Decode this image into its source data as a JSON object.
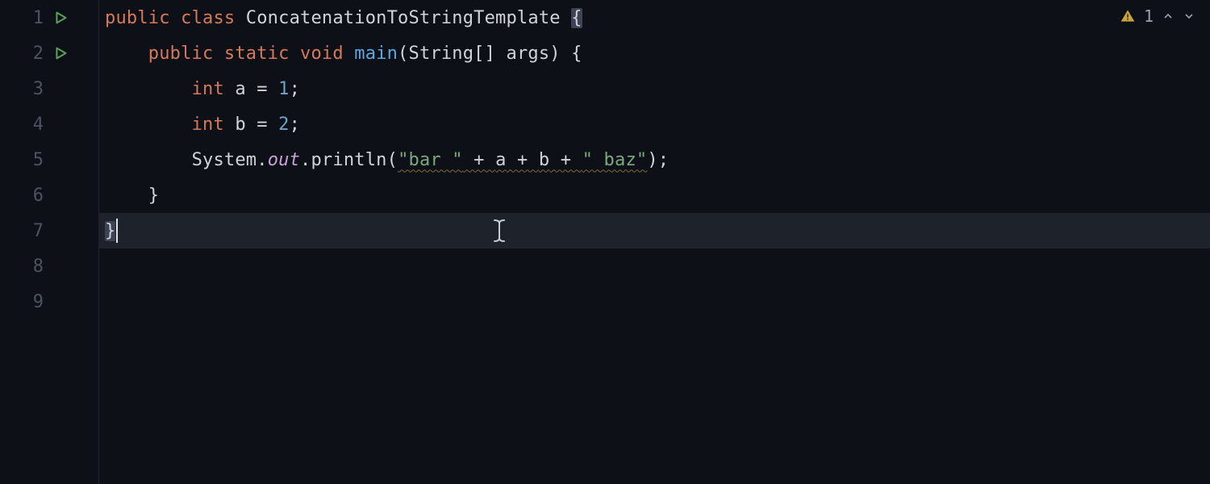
{
  "inspection": {
    "warning_count": "1"
  },
  "gutter": {
    "lines": [
      "1",
      "2",
      "3",
      "4",
      "5",
      "6",
      "7",
      "8",
      "9"
    ],
    "run_markers_on": [
      0,
      1
    ]
  },
  "code": {
    "lines": [
      {
        "indent": "",
        "tokens": [
          {
            "t": "public ",
            "c": "kw"
          },
          {
            "t": "class ",
            "c": "kw"
          },
          {
            "t": "ConcatenationToStringTemplate ",
            "c": "class"
          },
          {
            "t": "{",
            "c": "punc",
            "brace_hl": true
          }
        ]
      },
      {
        "indent": "    ",
        "tokens": [
          {
            "t": "public ",
            "c": "kw"
          },
          {
            "t": "static ",
            "c": "kw"
          },
          {
            "t": "void ",
            "c": "kw"
          },
          {
            "t": "main",
            "c": "method"
          },
          {
            "t": "(",
            "c": "punc"
          },
          {
            "t": "String",
            "c": "default"
          },
          {
            "t": "[] ",
            "c": "punc"
          },
          {
            "t": "args",
            "c": "default"
          },
          {
            "t": ") {",
            "c": "punc"
          }
        ]
      },
      {
        "indent": "        ",
        "tokens": [
          {
            "t": "int ",
            "c": "kw"
          },
          {
            "t": "a ",
            "c": "default"
          },
          {
            "t": "= ",
            "c": "punc"
          },
          {
            "t": "1",
            "c": "num"
          },
          {
            "t": ";",
            "c": "punc"
          }
        ]
      },
      {
        "indent": "        ",
        "tokens": [
          {
            "t": "int ",
            "c": "kw"
          },
          {
            "t": "b ",
            "c": "default"
          },
          {
            "t": "= ",
            "c": "punc"
          },
          {
            "t": "2",
            "c": "num"
          },
          {
            "t": ";",
            "c": "punc"
          }
        ]
      },
      {
        "indent": "        ",
        "tokens": [
          {
            "t": "System",
            "c": "default"
          },
          {
            "t": ".",
            "c": "punc"
          },
          {
            "t": "out",
            "c": "static"
          },
          {
            "t": ".",
            "c": "punc"
          },
          {
            "t": "println",
            "c": "default"
          },
          {
            "t": "(",
            "c": "punc"
          },
          {
            "t": "\"bar \"",
            "c": "string",
            "wavy": true
          },
          {
            "t": " + ",
            "c": "punc",
            "wavy": true
          },
          {
            "t": "a",
            "c": "default",
            "wavy": true
          },
          {
            "t": " + ",
            "c": "punc",
            "wavy": true
          },
          {
            "t": "b",
            "c": "default",
            "wavy": true
          },
          {
            "t": " + ",
            "c": "punc",
            "wavy": true
          },
          {
            "t": "\" baz\"",
            "c": "string",
            "wavy": true
          },
          {
            "t": ");",
            "c": "punc"
          }
        ]
      },
      {
        "indent": "    ",
        "tokens": [
          {
            "t": "}",
            "c": "punc"
          }
        ]
      },
      {
        "indent": "",
        "active": true,
        "caret_after": true,
        "text_cursor": true,
        "tokens": [
          {
            "t": "}",
            "c": "punc",
            "brace_hl": true
          }
        ]
      },
      {
        "indent": "",
        "tokens": []
      },
      {
        "indent": "",
        "tokens": []
      }
    ]
  }
}
